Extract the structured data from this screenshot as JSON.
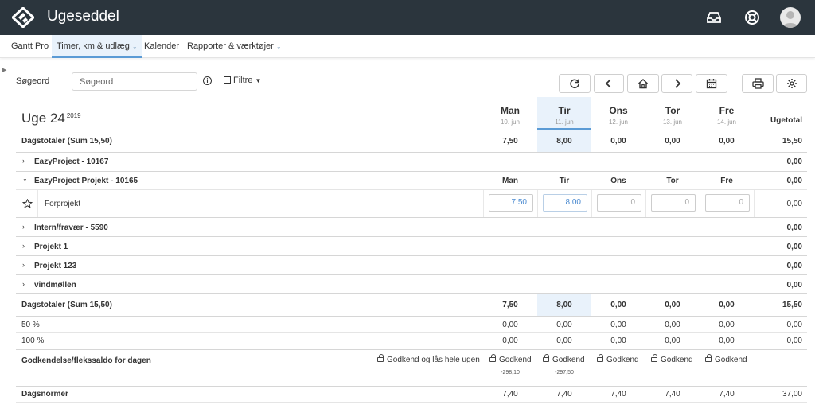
{
  "app": {
    "title": "Ugeseddel"
  },
  "nav": {
    "items": [
      {
        "label": "Gantt Pro"
      },
      {
        "label": "Timer, km & udlæg",
        "active": true
      },
      {
        "label": "Kalender"
      },
      {
        "label": "Rapporter & værktøjer"
      }
    ]
  },
  "toolbar": {
    "search_label": "Søgeord",
    "search_placeholder": "Søgeord",
    "filter_label": "Filtre"
  },
  "icons": {
    "topbar": [
      "inbox-icon",
      "help-lifebuoy-icon",
      "user-avatar"
    ],
    "toolbar": [
      "refresh-icon",
      "chevron-left-icon",
      "home-icon",
      "chevron-right-icon",
      "calendar-icon",
      "print-icon",
      "settings-gear-icon"
    ]
  },
  "week": {
    "title": "Uge 24",
    "year": "2019",
    "days": [
      {
        "name": "Man",
        "date": "10. jun"
      },
      {
        "name": "Tir",
        "date": "11. jun"
      },
      {
        "name": "Ons",
        "date": "12. jun"
      },
      {
        "name": "Tor",
        "date": "13. jun"
      },
      {
        "name": "Fre",
        "date": "14. jun"
      }
    ],
    "total_label": "Ugetotal"
  },
  "day_totals_top": {
    "label": "Dagstotaler (Sum 15,50)",
    "values": [
      "7,50",
      "8,00",
      "0,00",
      "0,00",
      "0,00"
    ],
    "total": "15,50"
  },
  "groups": [
    {
      "label": "EazyProject - 10167",
      "total": "0,00",
      "expanded": false
    },
    {
      "label": "EazyProject Projekt - 10165",
      "total": "0,00",
      "expanded": true,
      "day_headers": [
        "Man",
        "Tir",
        "Ons",
        "Tor",
        "Fre"
      ],
      "task": {
        "label": "Forprojekt",
        "values": [
          "7,50",
          "8,00",
          "0",
          "0",
          "0"
        ],
        "total": "0,00"
      }
    },
    {
      "label": "Intern/fravær - 5590",
      "total": "0,00",
      "expanded": false
    },
    {
      "label": "Projekt 1",
      "total": "0,00",
      "expanded": false
    },
    {
      "label": "Projekt 123",
      "total": "0,00",
      "expanded": false
    },
    {
      "label": "vindmøllen",
      "total": "0,00",
      "expanded": false
    }
  ],
  "day_totals_bottom": {
    "label": "Dagstotaler (Sum 15,50)",
    "values": [
      "7,50",
      "8,00",
      "0,00",
      "0,00",
      "0,00"
    ],
    "total": "15,50"
  },
  "rates": [
    {
      "label": "50 %",
      "values": [
        "0,00",
        "0,00",
        "0,00",
        "0,00",
        "0,00"
      ],
      "total": "0,00"
    },
    {
      "label": "100 %",
      "values": [
        "0,00",
        "0,00",
        "0,00",
        "0,00",
        "0,00"
      ],
      "total": "0,00"
    }
  ],
  "approval": {
    "label": "Godkendelse/flekssaldo for dagen",
    "lock_week_label": "Godkend og lås hele ugen",
    "day_label": "Godkend",
    "saldos": [
      "-298,10",
      "-297,50",
      "",
      "",
      ""
    ]
  },
  "norms": {
    "label": "Dagsnormer",
    "values": [
      "7,40",
      "7,40",
      "7,40",
      "7,40",
      "7,40"
    ],
    "total": "37,00"
  }
}
